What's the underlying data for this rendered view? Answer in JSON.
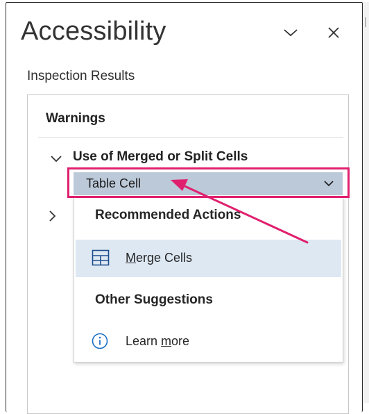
{
  "pane": {
    "title": "Accessibility",
    "collapse_icon": "chevron-down-icon",
    "close_icon": "close-icon"
  },
  "inspection": {
    "subtitle": "Inspection Results",
    "section_heading": "Warnings",
    "issue": {
      "label": "Use of Merged or Split Cells",
      "expanded": true
    },
    "dropdown": {
      "selected_value": "Table Cell"
    }
  },
  "menu": {
    "recommended_heading": "Recommended Actions",
    "merge_cells": {
      "prefix": "",
      "mnemonic": "M",
      "rest": "erge Cells",
      "icon": "table-grid-icon"
    },
    "other_heading": "Other Suggestions",
    "learn_more": {
      "prefix": "Learn ",
      "mnemonic": "m",
      "rest": "ore",
      "icon": "info-icon"
    }
  },
  "annotation": {
    "highlight_color": "#e0206f",
    "arrow_color": "#e0206f"
  },
  "colors": {
    "dropdown_bg": "#bcc9d9",
    "selected_item_bg": "#dde8f3",
    "info_icon": "#1a6fc4"
  }
}
